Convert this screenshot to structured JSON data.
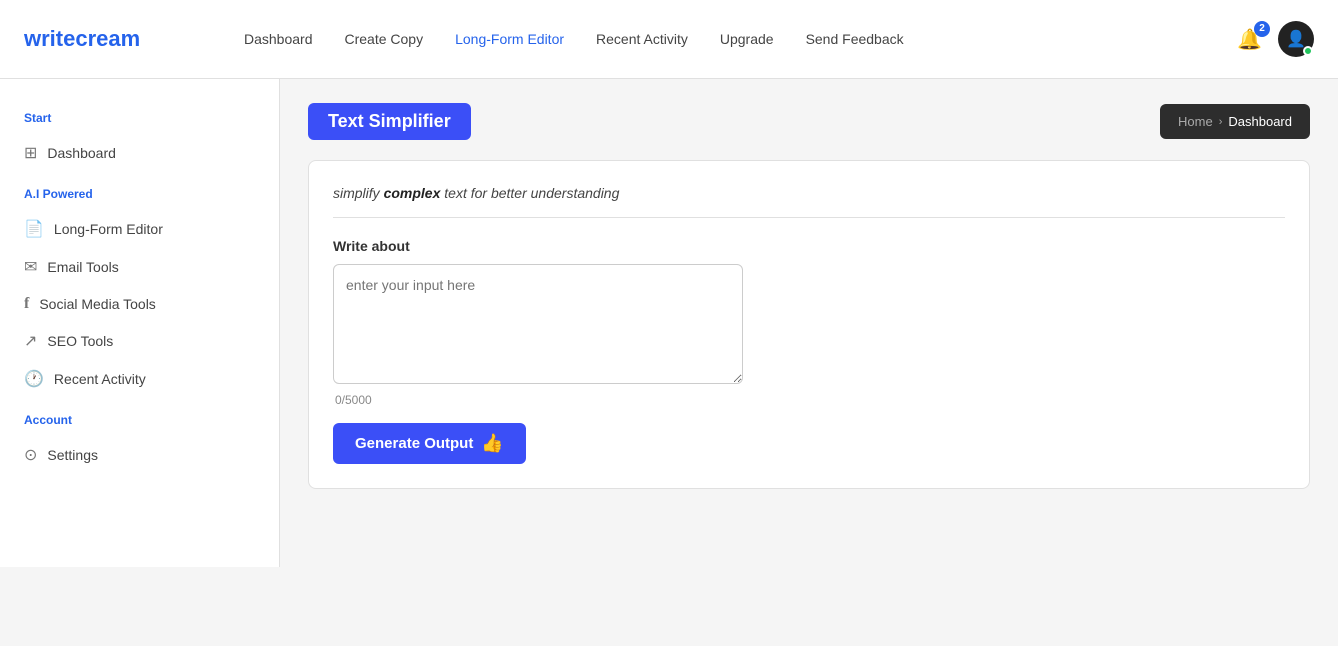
{
  "logo": {
    "prefix": "write",
    "suffix": "cream"
  },
  "topnav": {
    "links": [
      {
        "label": "Dashboard",
        "active": false
      },
      {
        "label": "Create Copy",
        "active": false
      },
      {
        "label": "Long-Form Editor",
        "active": false
      },
      {
        "label": "Recent Activity",
        "active": false
      },
      {
        "label": "Upgrade",
        "active": false
      },
      {
        "label": "Send Feedback",
        "active": false
      }
    ],
    "notification_count": "2"
  },
  "breadcrumb": {
    "home": "Home",
    "separator": "›",
    "current": "Dashboard"
  },
  "sidebar": {
    "section_start": "Start",
    "items_start": [
      {
        "label": "Dashboard",
        "icon": "⊞"
      }
    ],
    "section_ai": "A.I Powered",
    "items_ai": [
      {
        "label": "Long-Form Editor",
        "icon": "📄"
      },
      {
        "label": "Email Tools",
        "icon": "✉"
      },
      {
        "label": "Social Media Tools",
        "icon": "f"
      },
      {
        "label": "SEO Tools",
        "icon": "↗"
      },
      {
        "label": "Recent Activity",
        "icon": "🕐"
      }
    ],
    "section_account": "Account",
    "items_account": [
      {
        "label": "Settings",
        "icon": "⊙"
      }
    ]
  },
  "main": {
    "page_title": "Text Simplifier",
    "card_subtitle_normal": "simplify ",
    "card_subtitle_bold": "complex",
    "card_subtitle_rest": " text for better understanding",
    "form_label": "Write about",
    "textarea_placeholder": "enter your input here",
    "char_count": "0/5000",
    "generate_btn_label": "Generate Output",
    "generate_btn_icon": "👍"
  }
}
